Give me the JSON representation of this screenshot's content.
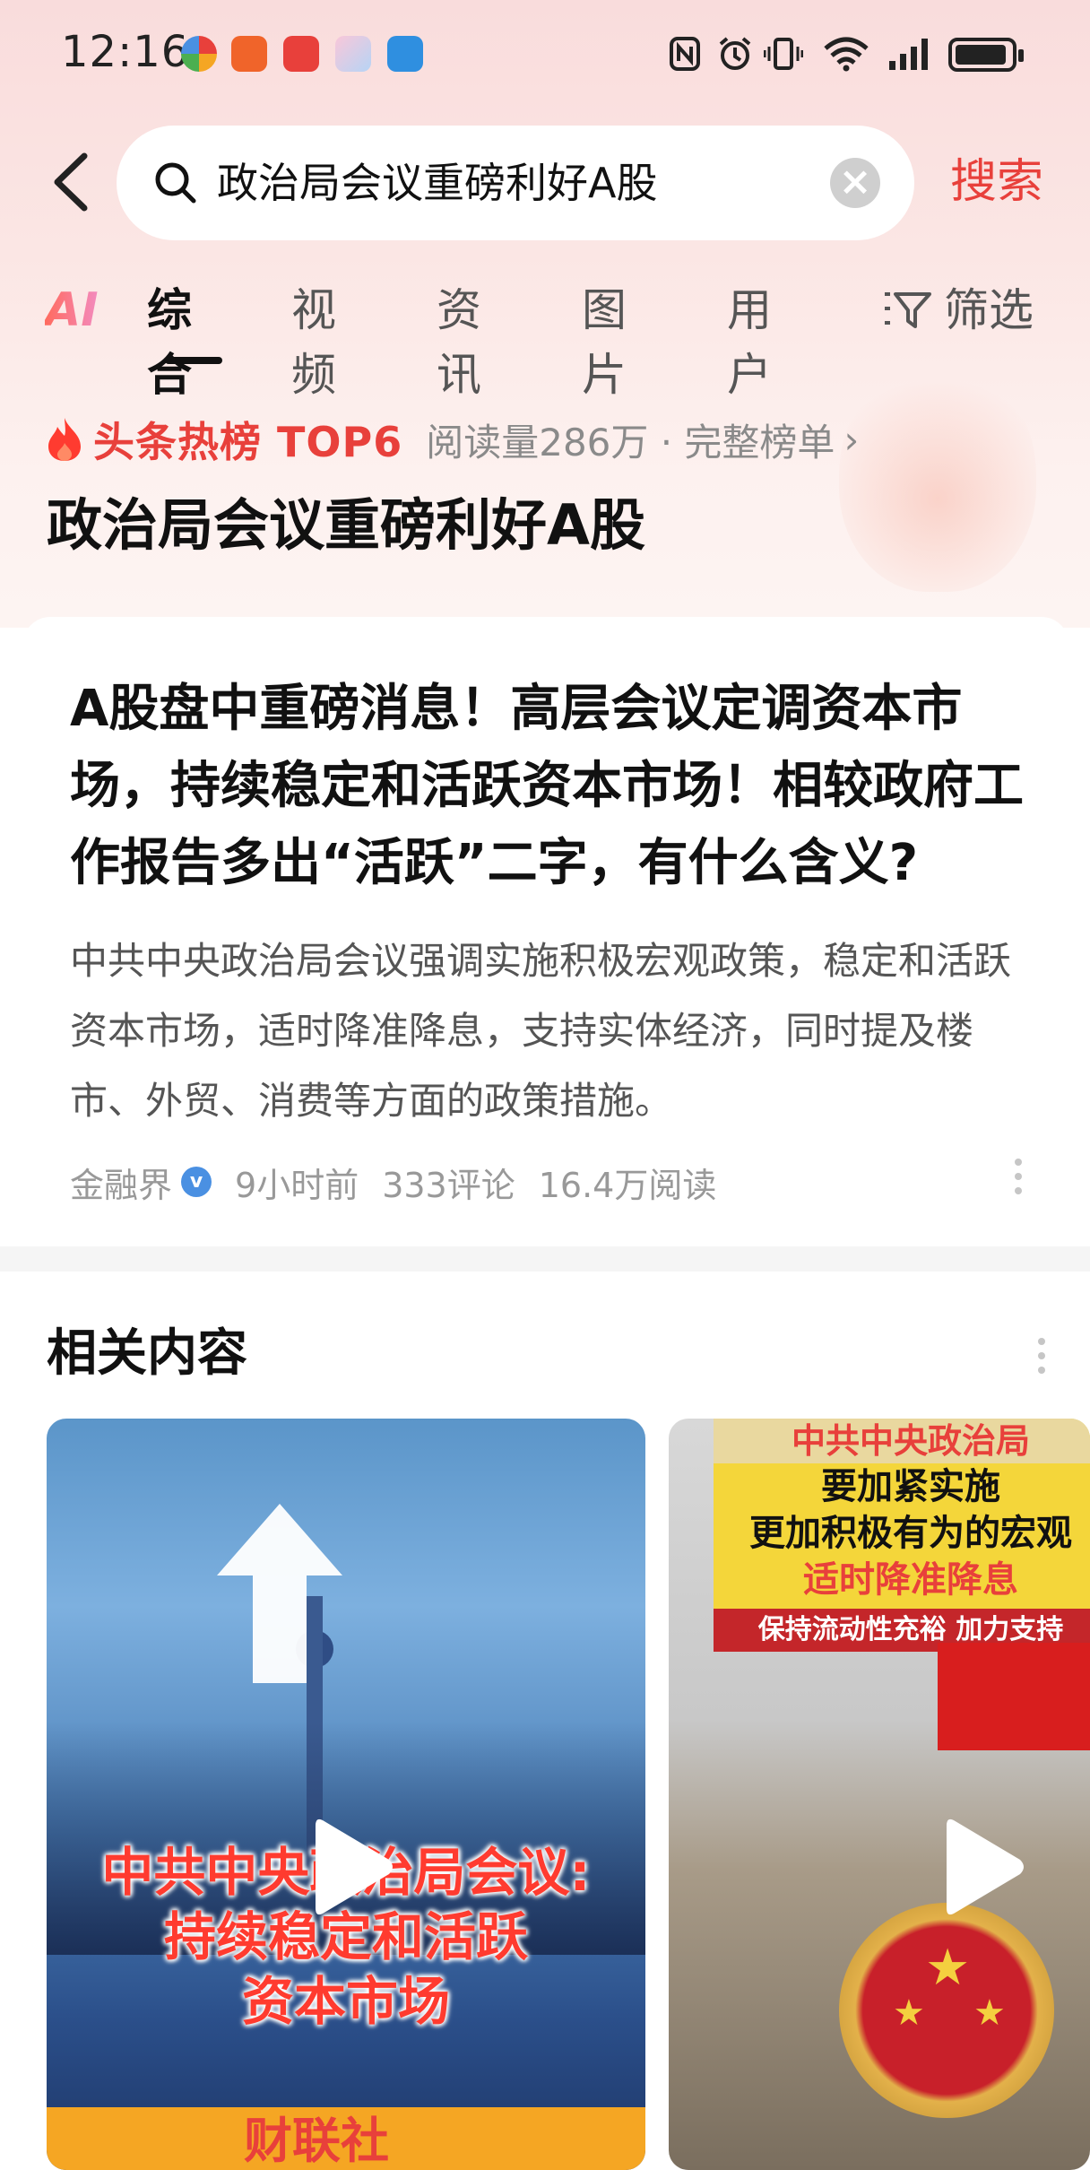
{
  "status_bar": {
    "time": "12:16"
  },
  "search": {
    "query": "政治局会议重磅利好A股",
    "submit_label": "搜索"
  },
  "tabs": {
    "ai_label": "AI",
    "items": [
      "综合",
      "视频",
      "资讯",
      "图片",
      "用户"
    ],
    "active": "综合",
    "filter_label": "筛选"
  },
  "hot_board": {
    "label": "头条热榜 TOP6",
    "meta": "阅读量286万 · 完整榜单",
    "topic_title": "政治局会议重磅利好A股"
  },
  "article": {
    "title": "A股盘中重磅消息！高层会议定调资本市场，持续稳定和活跃资本市场！相较政府工作报告多出“活跃”二字，有什么含义?",
    "summary": "中共中央政治局会议强调实施积极宏观政策，稳定和活跃资本市场，适时降准降息，支持实体经济，同时提及楼市、外贸、消费等方面的政策措施。",
    "source": "金融界",
    "time_ago": "9小时前",
    "comments": "333评论",
    "reads": "16.4万阅读"
  },
  "related": {
    "title": "相关内容",
    "video1": {
      "overlay_lines": [
        "中共中央政治局会议:",
        "持续稳定和活跃",
        "资本市场"
      ],
      "logo_text": "财联社"
    },
    "video2": {
      "banner_top": "中共中央政治局",
      "banner_line1": "要加紧实施",
      "banner_line2": "更加积极有为的宏观",
      "banner_line3": "适时降准降息",
      "banner_line4": "保持流动性充裕 加力支持"
    }
  },
  "colors": {
    "accent": "#e8403b",
    "text_primary": "#111111",
    "text_secondary": "#555555",
    "text_muted": "#999999",
    "verified_badge": "#4a90e2"
  },
  "icons": {
    "back": "chevron-left-icon",
    "search": "search-icon",
    "clear": "clear-icon",
    "filter": "filter-icon",
    "fire": "fire-icon",
    "verified": "verified-icon",
    "more": "more-vertical-icon",
    "play": "play-icon"
  }
}
